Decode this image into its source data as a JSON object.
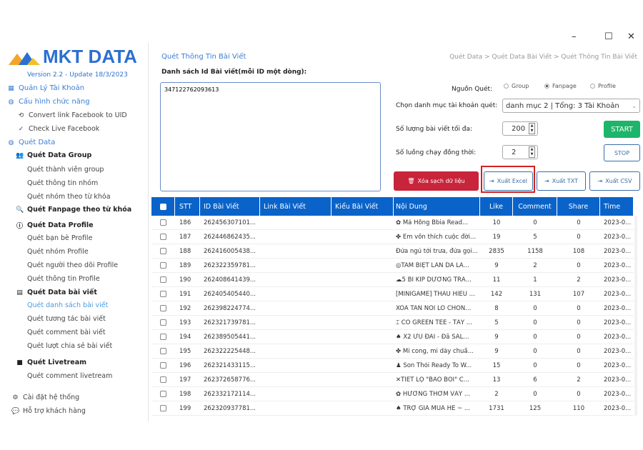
{
  "window": {
    "minimize": "–",
    "maximize": "☐",
    "close": "✕"
  },
  "sidebar": {
    "logo": "MKT DATA",
    "version": "Version 2.2 - Update 18/3/2023",
    "items": [
      {
        "label": "Quản Lý Tài Khoản",
        "icon": "▦"
      },
      {
        "label": "Cấu hình chức năng",
        "icon": "◍"
      },
      {
        "label": "Convert link Facebook to UID",
        "icon": "⟲"
      },
      {
        "label": "Check Live Facebook",
        "icon": "✓"
      },
      {
        "label": "Quét Data",
        "icon": "◍"
      },
      {
        "label": "Quét Data Group",
        "icon": "👥"
      },
      {
        "label": "Quét thành viên group"
      },
      {
        "label": "Quét thông tin nhóm"
      },
      {
        "label": "Quét nhóm theo từ khóa"
      },
      {
        "label": "Quét Fanpage theo từ khóa",
        "icon": "🔍"
      },
      {
        "label": "Quét Data Profile",
        "icon": "ⓘ"
      },
      {
        "label": "Quét bạn bè Profile"
      },
      {
        "label": "Quét nhóm Profile"
      },
      {
        "label": "Quét người theo dõi Profile"
      },
      {
        "label": "Quét thông tin Profile"
      },
      {
        "label": "Quét Data bài viết",
        "icon": "▤"
      },
      {
        "label": "Quét danh sách bài viết"
      },
      {
        "label": "Quét tương tác bài viết"
      },
      {
        "label": "Quét comment bài viết"
      },
      {
        "label": "Quét lượt chia sẻ bài viết"
      },
      {
        "label": "Quét Livetream",
        "icon": "■"
      },
      {
        "label": "Quét comment livetream"
      },
      {
        "label": "Cài đặt hệ thống",
        "icon": "⚙"
      },
      {
        "label": "Hỗ trợ khách hàng",
        "icon": "💬"
      }
    ]
  },
  "main": {
    "title": "Quét Thông Tin Bài Viết",
    "breadcrumb": "Quét Data > Quét Data Bài Viết > Quét Thông Tin Bài Viết",
    "id_list_label": "Danh sách Id Bài viết(mỗi ID một dòng):",
    "id_list_value": "347122762093613",
    "source_label": "Nguồn Quét:",
    "sources": [
      "Group",
      "Fanpage",
      "Profile"
    ],
    "source_selected": "Fanpage",
    "category_label": "Chọn danh mục tài khoản quét:",
    "category_value": "danh mục 2 | Tổng: 3 Tài Khoản",
    "max_posts_label": "Số lượng bài viết tối đa:",
    "max_posts": "200",
    "threads_label": "Số luồng chạy đồng thời:",
    "threads": "2",
    "start": "START",
    "stop": "STOP",
    "clear": "Xóa sạch dữ liệu",
    "excel": "Xuất Excel",
    "txt": "Xuất TXT",
    "csv": "Xuất CSV"
  },
  "table": {
    "columns": [
      "STT",
      "ID Bài Viết",
      "Link Bài Viết",
      "Kiểu Bài Viết",
      "Nội Dung",
      "Like",
      "Comment",
      "Share",
      "Time"
    ],
    "rows": [
      [
        "186",
        "262456307101...",
        "",
        "",
        "✿ Má Hồng Bbia Read...",
        "10",
        "0",
        "0",
        "2023-0..."
      ],
      [
        "187",
        "262446862435...",
        "",
        "",
        "✤ Em vốn thích cuộc đời...",
        "19",
        "5",
        "0",
        "2023-0..."
      ],
      [
        "188",
        "262416005438...",
        "",
        "",
        "Đứa ngủ tới trưa, đứa gọi...",
        "2835",
        "1158",
        "108",
        "2023-0..."
      ],
      [
        "189",
        "262322359781...",
        "",
        "",
        "◎TAM BIỆT LÀN DA LẢ...",
        "9",
        "2",
        "0",
        "2023-0..."
      ],
      [
        "190",
        "262408641439...",
        "",
        "",
        "☁5 BÍ KÍP DƯỠNG TRẮ...",
        "11",
        "1",
        "2",
        "2023-0..."
      ],
      [
        "191",
        "262405405440...",
        "",
        "",
        "[MINIGAME] THẤU HIỂU ...",
        "142",
        "131",
        "107",
        "2023-0..."
      ],
      [
        "192",
        "262398224774...",
        "",
        "",
        "XOÁ TAN NỖI LO CHỐN...",
        "8",
        "0",
        "0",
        "2023-0..."
      ],
      [
        "193",
        "262321739781...",
        "",
        "",
        "⌶ CÓ GREEN TEE - TẨY ...",
        "5",
        "0",
        "0",
        "2023-0..."
      ],
      [
        "194",
        "262389505441...",
        "",
        "",
        "♠ X2 ƯU ĐÃI - Đã SAL...",
        "9",
        "0",
        "0",
        "2023-0..."
      ],
      [
        "195",
        "262322225448...",
        "",
        "",
        "✤ Mi cong, mi dày chuẩ...",
        "9",
        "0",
        "0",
        "2023-0..."
      ],
      [
        "196",
        "262321433115...",
        "",
        "",
        "♟ Son Thỏi Ready To W...",
        "15",
        "0",
        "0",
        "2023-0..."
      ],
      [
        "197",
        "262372658776...",
        "",
        "",
        "✕TIẾT LỘ \"BẢO BỐI\" C...",
        "13",
        "6",
        "2",
        "2023-0..."
      ],
      [
        "198",
        "262332172114...",
        "",
        "",
        "✿ HƯƠNG THƠM VẪY ...",
        "2",
        "0",
        "0",
        "2023-0..."
      ],
      [
        "199",
        "262320937781...",
        "",
        "",
        "♠ TRỢ GIÁ MÙA HÈ ~ ...",
        "1731",
        "125",
        "110",
        "2023-0..."
      ]
    ]
  },
  "colors": {
    "accent": "#0a63c9",
    "start": "#1db56a",
    "clear": "#c8243a",
    "highlight": "#d42020"
  }
}
